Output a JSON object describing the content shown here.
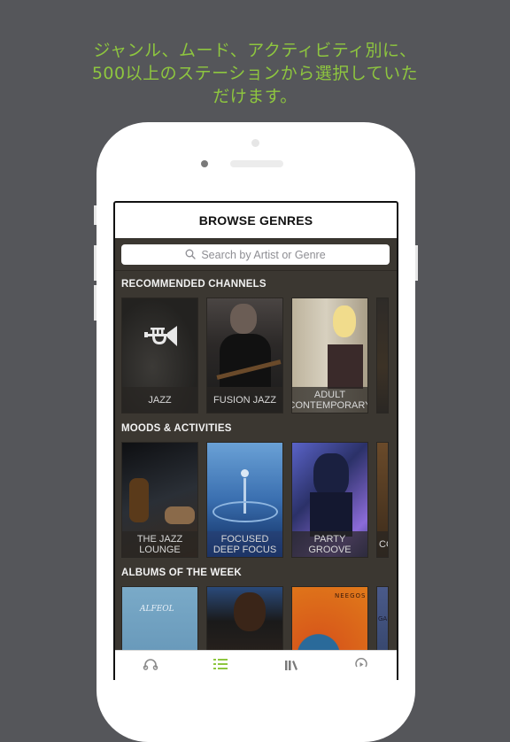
{
  "promo": {
    "lines": [
      "ジャンル、ムード、アクティビティ別に、",
      "500以上のステーションから選択していた",
      "だけます。"
    ],
    "color": "#8ec63f"
  },
  "app": {
    "nav_title": "BROWSE GENRES",
    "search": {
      "placeholder": "Search by Artist or Genre",
      "icon": "search-icon"
    },
    "sections": [
      {
        "title": "RECOMMENDED CHANNELS",
        "cards": [
          {
            "label": "JAZZ",
            "icon": "trumpet-icon"
          },
          {
            "label": "FUSION JAZZ"
          },
          {
            "label": "ADULT CONTEMPORARY"
          },
          {
            "label": ""
          }
        ]
      },
      {
        "title": "MOODS & ACTIVITIES",
        "cards": [
          {
            "label": "THE JAZZ LOUNGE"
          },
          {
            "label": "FOCUSED DEEP FOCUS"
          },
          {
            "label": "PARTY GROOVE"
          },
          {
            "label": "CO"
          }
        ]
      },
      {
        "title": "ALBUMS OF THE WEEK",
        "cards": [
          {
            "label": "",
            "cover_text": "ALFEOL"
          },
          {
            "label": ""
          },
          {
            "label": "",
            "cover_text": "NEEGOS"
          },
          {
            "label": "",
            "cover_text": "GAM"
          }
        ]
      }
    ],
    "tabs": [
      {
        "name": "listen",
        "icon": "headphones-icon",
        "active": false
      },
      {
        "name": "browse",
        "icon": "list-icon",
        "active": true
      },
      {
        "name": "library",
        "icon": "library-icon",
        "active": false
      },
      {
        "name": "history",
        "icon": "recent-play-icon",
        "active": false
      }
    ],
    "accent_color": "#8ec63f"
  }
}
